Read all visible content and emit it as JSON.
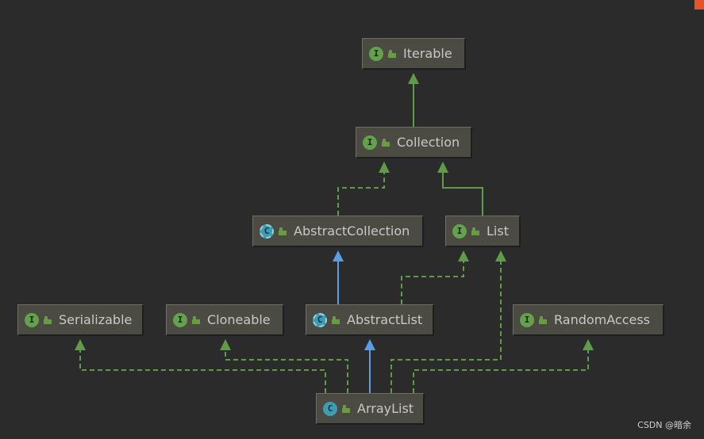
{
  "nodes": [
    {
      "id": "iterable",
      "label": "Iterable",
      "kind": "interface"
    },
    {
      "id": "collection",
      "label": "Collection",
      "kind": "interface"
    },
    {
      "id": "abstractcollection",
      "label": "AbstractCollection",
      "kind": "abstract-class"
    },
    {
      "id": "list",
      "label": "List",
      "kind": "interface"
    },
    {
      "id": "serializable",
      "label": "Serializable",
      "kind": "interface"
    },
    {
      "id": "cloneable",
      "label": "Cloneable",
      "kind": "interface"
    },
    {
      "id": "abstractlist",
      "label": "AbstractList",
      "kind": "abstract-class"
    },
    {
      "id": "randomaccess",
      "label": "RandomAccess",
      "kind": "interface"
    },
    {
      "id": "arraylist",
      "label": "ArrayList",
      "kind": "class"
    }
  ],
  "edges": [
    {
      "from": "collection",
      "to": "iterable",
      "type": "extends-interface"
    },
    {
      "from": "abstractcollection",
      "to": "collection",
      "type": "implements"
    },
    {
      "from": "list",
      "to": "collection",
      "type": "extends-interface"
    },
    {
      "from": "abstractlist",
      "to": "abstractcollection",
      "type": "extends-class"
    },
    {
      "from": "abstractlist",
      "to": "list",
      "type": "implements"
    },
    {
      "from": "arraylist",
      "to": "serializable",
      "type": "implements"
    },
    {
      "from": "arraylist",
      "to": "cloneable",
      "type": "implements"
    },
    {
      "from": "arraylist",
      "to": "abstractlist",
      "type": "extends-class"
    },
    {
      "from": "arraylist",
      "to": "list",
      "type": "implements"
    },
    {
      "from": "arraylist",
      "to": "randomaccess",
      "type": "implements"
    }
  ],
  "colors": {
    "background": "#2b2b2b",
    "node_fill": "#4b4b43",
    "node_text": "#c8c8c8",
    "interface_edge": "#5e9c47",
    "class_edge": "#5b9ee8",
    "interface_icon": "#62a24a",
    "class_icon": "#3d9db5"
  },
  "icon_letters": {
    "interface": "I",
    "class": "C"
  },
  "watermark": "CSDN @暗余"
}
